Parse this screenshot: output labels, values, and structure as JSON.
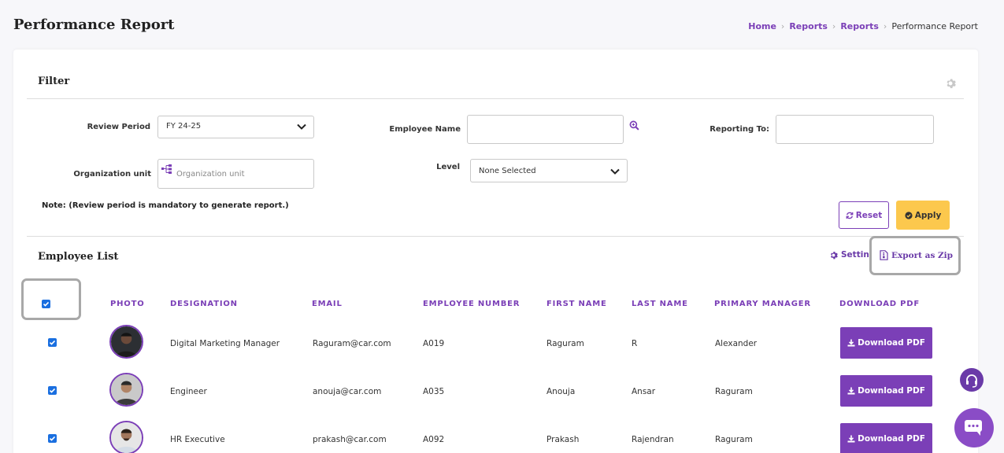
{
  "page": {
    "title": "Performance Report"
  },
  "breadcrumb": {
    "items": [
      "Home",
      "Reports",
      "Reports"
    ],
    "current": "Performance Report"
  },
  "filter": {
    "title": "Filter",
    "review_period": {
      "label": "Review Period",
      "value": "FY 24-25"
    },
    "employee_name": {
      "label": "Employee Name",
      "value": ""
    },
    "reporting_to": {
      "label": "Reporting To:",
      "value": ""
    },
    "org_unit": {
      "label": "Organization unit",
      "placeholder": "Organization unit"
    },
    "level": {
      "label": "Level",
      "value": "None Selected"
    },
    "note": "Note: (Review period is mandatory to generate report.)",
    "reset_label": "Reset",
    "apply_label": "Apply"
  },
  "employee_list": {
    "title": "Employee List",
    "setting_label": "Settings",
    "export_label": "Export as Zip",
    "columns": [
      "PHOTO",
      "DESIGNATION",
      "EMAIL",
      "EMPLOYEE NUMBER",
      "FIRST NAME",
      "LAST NAME",
      "PRIMARY MANAGER",
      "DOWNLOAD PDF"
    ],
    "download_label": "Download PDF",
    "rows": [
      {
        "designation": "Digital Marketing Manager",
        "email": "Raguram@car.com",
        "employee_number": "A019",
        "first_name": "Raguram",
        "last_name": "R",
        "primary_manager": "Alexander",
        "checked": true
      },
      {
        "designation": "Engineer",
        "email": "anouja@car.com",
        "employee_number": "A035",
        "first_name": "Anouja",
        "last_name": "Ansar",
        "primary_manager": "Raguram",
        "checked": true
      },
      {
        "designation": "HR Executive",
        "email": "prakash@car.com",
        "employee_number": "A092",
        "first_name": "Prakash",
        "last_name": "Rajendran",
        "primary_manager": "Raguram",
        "checked": true
      }
    ]
  },
  "icons": {
    "settings": "gear-icon",
    "search": "search-icon",
    "org": "org-tree-icon",
    "reset": "refresh-icon",
    "apply": "check-circle-icon",
    "export": "file-zip-icon",
    "download": "download-icon",
    "support": "headset-icon",
    "chat": "chat-icon"
  },
  "colors": {
    "accent": "#7b3fb7",
    "apply": "#fcc84d",
    "checkbox": "#1a6fe0"
  }
}
